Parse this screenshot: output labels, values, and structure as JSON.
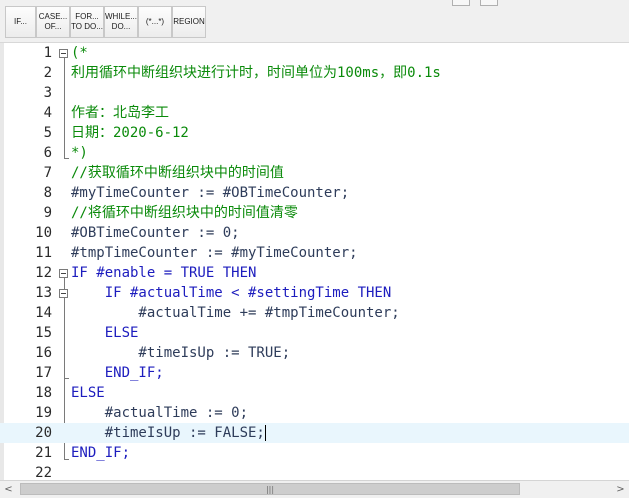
{
  "toolbar": {
    "buttons": [
      {
        "label": "IF..."
      },
      {
        "label": "CASE...\nOF..."
      },
      {
        "label": "FOR...\nTO DO..."
      },
      {
        "label": "WHILE...\nDO..."
      },
      {
        "label": "(*...*)"
      },
      {
        "label": "REGION"
      }
    ]
  },
  "editor": {
    "lines": [
      {
        "n": "1",
        "text": "(*"
      },
      {
        "n": "2",
        "text": "利用循环中断组织块进行计时，时间单位为100ms，即0.1s"
      },
      {
        "n": "3",
        "text": ""
      },
      {
        "n": "4",
        "text": "作者：北岛李工"
      },
      {
        "n": "5",
        "text": "日期：2020-6-12"
      },
      {
        "n": "6",
        "text": "*)"
      },
      {
        "n": "7",
        "text": "//获取循环中断组织块中的时间值"
      },
      {
        "n": "8",
        "text": "#myTimeCounter := #OBTimeCounter;"
      },
      {
        "n": "9",
        "text": "//将循环中断组织块中的时间值清零"
      },
      {
        "n": "10",
        "text": "#OBTimeCounter := 0;"
      },
      {
        "n": "11",
        "text": "#tmpTimeCounter := #myTimeCounter;"
      },
      {
        "n": "12",
        "text": "IF #enable = TRUE THEN"
      },
      {
        "n": "13",
        "text": "    IF #actualTime < #settingTime THEN"
      },
      {
        "n": "14",
        "text": "        #actualTime += #tmpTimeCounter;"
      },
      {
        "n": "15",
        "text": "    ELSE"
      },
      {
        "n": "16",
        "text": "        #timeIsUp := TRUE;"
      },
      {
        "n": "17",
        "text": "    END_IF;"
      },
      {
        "n": "18",
        "text": "ELSE"
      },
      {
        "n": "19",
        "text": "    #actualTime := 0;"
      },
      {
        "n": "20",
        "text": "    #timeIsUp := FALSE;"
      },
      {
        "n": "21",
        "text": "END_IF;"
      },
      {
        "n": "22",
        "text": ""
      }
    ]
  },
  "scrollbar": {
    "left_arrow": "<",
    "right_arrow": ">",
    "grip": "|||"
  },
  "colors": {
    "comment": "#0a8a0a",
    "keyword": "#1c1cbe",
    "variable": "#2e3c5a",
    "current_line": "#e9f6fd"
  }
}
